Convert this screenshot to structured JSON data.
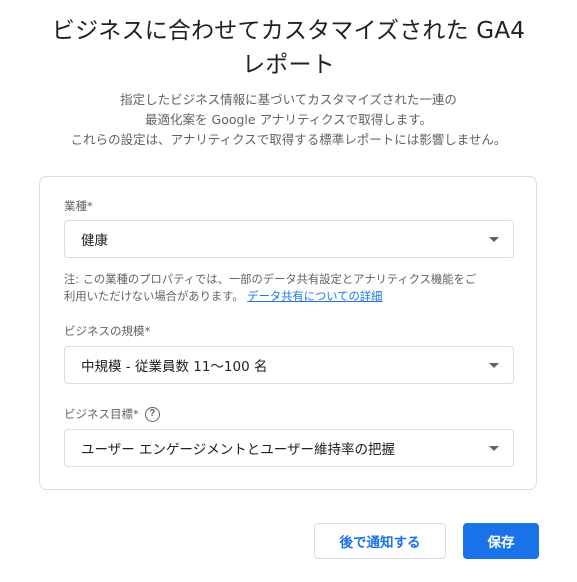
{
  "dialog": {
    "title_lines": [
      "ビジネスに合わせてカスタマイズされた GA4",
      "レポート"
    ],
    "description_lines": [
      "指定したビジネス情報に基づいてカスタマイズされた一連の",
      "最適化案を Google アナリティクスで取得します。",
      "これらの設定は、アナリティクスで取得する標準レポートには影響しません。"
    ]
  },
  "form": {
    "industry": {
      "label": "業種*",
      "value": "健康"
    },
    "note": {
      "line1": "注: この業種のプロパティでは、一部のデータ共有設定とアナリティクス機能をご",
      "line2_prefix": "利用いただけない場合があります。",
      "link_text": "データ共有についての詳細"
    },
    "business_size": {
      "label": "ビジネスの規模*",
      "value": "中規模 - 従業員数 11〜100 名"
    },
    "business_goal": {
      "label": "ビジネス目標*",
      "help_icon": "help-circle-icon",
      "value": "ユーザー エンゲージメントとユーザー維持率の把握"
    }
  },
  "actions": {
    "later_label": "後で通知する",
    "save_label": "保存"
  },
  "colors": {
    "primary": "#1a73e8",
    "text": "#202124",
    "secondary_text": "#5f6368",
    "border": "#dadce0"
  }
}
